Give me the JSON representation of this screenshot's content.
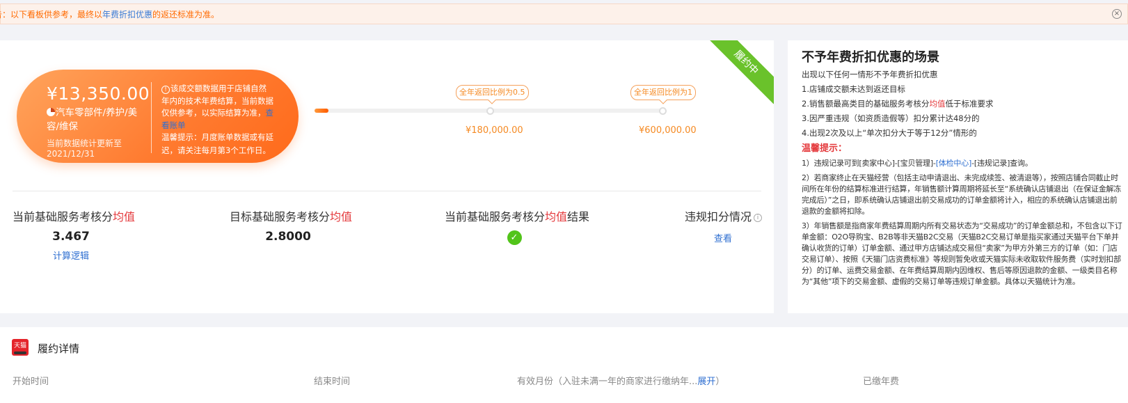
{
  "notice": {
    "prefix": "告：以下看板供参考，最终以",
    "highlight": "年费折扣优惠",
    "suffix": "的返还标准为准。",
    "close_icon": "close-circle-icon"
  },
  "summary": {
    "status_ribbon": "履约中",
    "amount": "¥13,350.00",
    "category_icon": "pie-chart-icon",
    "category": "汽车零部件/养护/美容/维保",
    "updated_line1": "当前数据统计更新至",
    "updated_line2": "2021/12/31",
    "desc_icon": "info-circle-icon",
    "desc_text": "该成交额数据用于店铺自然年内的技术年费结算，当前数据仅供参考，以实际结算为准，",
    "desc_link": "查看账单",
    "warm_tip": "温馨提示：月度账单数据或有延迟，请关注每月第3个工作日。"
  },
  "progress": {
    "fill_fraction": 0.04,
    "milestones": [
      {
        "bubble": "全年返回比例为0.5",
        "amount": "¥180,000.00"
      },
      {
        "bubble": "全年返回比例为1",
        "amount": "¥600,000.00"
      }
    ]
  },
  "metrics": {
    "current": {
      "label_pre": "当前基础服务考核分",
      "label_hl": "均值",
      "value": "3.467",
      "link": "计算逻辑"
    },
    "target": {
      "label_pre": "目标基础服务考核分",
      "label_hl": "均值",
      "value": "2.8000"
    },
    "result": {
      "label_pre": "当前基础服务考核分",
      "label_hl": "均值",
      "label_post": "结果",
      "icon": "check-circle-icon",
      "status_color": "#52c41a"
    },
    "violation": {
      "label": "违规扣分情况",
      "icon": "question-circle-icon",
      "link": "查看"
    }
  },
  "side": {
    "title": "不予年费折扣优惠的场景",
    "subtitle": "出现以下任何一情形不予年费折扣优惠",
    "rules": [
      {
        "pre": "1.店铺成交额未达到返还目标"
      },
      {
        "pre": "2.销售额最高类目的基础服务考核分",
        "hl": "均值",
        "post": "低于标准要求"
      },
      {
        "pre": "3.因严重违规（如资质造假等）扣分累计达48分的"
      },
      {
        "pre": "4.出现2次及以上“单次扣分大于等于12分”情形的"
      }
    ],
    "warm_title": "温馨提示：",
    "notes": {
      "n1_pre": "1）违规记录可到[卖家中心]-[宝贝管理]-",
      "n1_link": "[体检中心]",
      "n1_post": "-[违规记录]查询。",
      "n2": "2）若商家终止在天猫经营（包括主动申请退出、未完成续签、被清退等），按照店铺合同截止时间所在年份的结算标准进行结算，年销售额计算周期将延长至“系统确认店铺退出（在保证金解冻完成后）”之日，即系统确认店铺退出前交易成功的订单金额将计入，相应的系统确认店铺退出前退款的金额将扣除。",
      "n3": "3）年销售额是指商家年费结算周期内所有交易状态为“交易成功”的订单金额总和，不包含以下订单金额：O2O导购宝、B2B等非天猫B2C交易（天猫B2C交易订单是指买家通过天猫平台下单并确认收货的订单）订单金额、通过甲方店铺达成交易但“卖家”为甲方外第三方的订单（如：门店交易订单）、按照《天猫门店资费标准》等规则暂免收或天猫实际未收取软件服务费（实时划扣部分）的订单、运费交易金额、在年费结算周期内因维权、售后等原因退款的金额、一级类目名称为“其他”项下的交易金额、虚假的交易订单等违规订单金额。具体以天猫统计为准。"
    }
  },
  "detail": {
    "logo_icon": "tmall-logo-icon",
    "logo_text": "天猫",
    "title": "履约详情",
    "columns": {
      "start": "开始时间",
      "end": "结束时间",
      "valid_pre": "有效月份（入驻未满一年的商家进行缴纳年...",
      "valid_link": "展开",
      "valid_post": "）",
      "paid": "已缴年费"
    }
  }
}
